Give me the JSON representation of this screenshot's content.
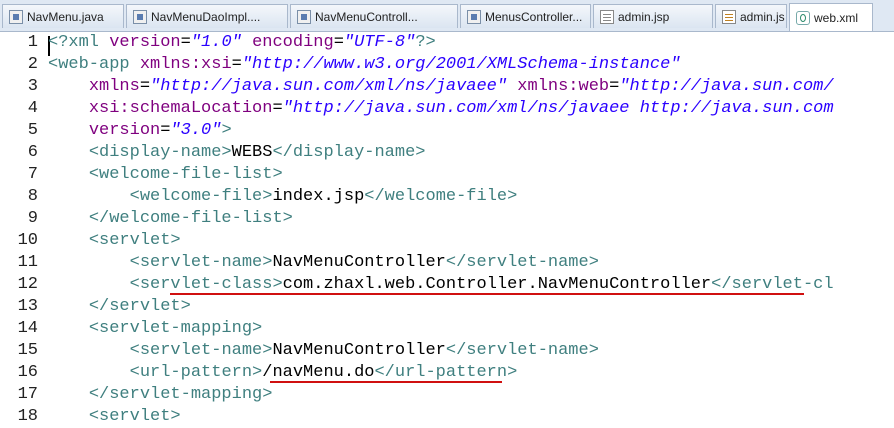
{
  "tabs": [
    {
      "label": "NavMenu.java",
      "icon": "java-file-icon",
      "active": false
    },
    {
      "label": "NavMenuDaoImpl....",
      "icon": "java-file-icon",
      "active": false
    },
    {
      "label": "NavMenuControll...",
      "icon": "java-file-icon",
      "active": false
    },
    {
      "label": "MenusController...",
      "icon": "java-file-icon",
      "active": false
    },
    {
      "label": "admin.jsp",
      "icon": "jsp-file-icon",
      "active": false
    },
    {
      "label": "admin.js",
      "icon": "js-file-icon",
      "active": false
    },
    {
      "label": "web.xml",
      "icon": "xml-file-icon",
      "active": true
    }
  ],
  "editor": {
    "lines": [
      {
        "num": "1",
        "tokens": [
          [
            "tag",
            "<?xml "
          ],
          [
            "attr",
            "version"
          ],
          [
            "txt",
            "="
          ],
          [
            "val",
            "\"1.0\""
          ],
          [
            "txt",
            " "
          ],
          [
            "attr",
            "encoding"
          ],
          [
            "txt",
            "="
          ],
          [
            "val",
            "\"UTF-8\""
          ],
          [
            "tag",
            "?>"
          ]
        ]
      },
      {
        "num": "2",
        "tokens": [
          [
            "tag",
            "<web-app "
          ],
          [
            "attr",
            "xmlns:xsi"
          ],
          [
            "txt",
            "="
          ],
          [
            "val",
            "\"http://www.w3.org/2001/XMLSchema-instance\""
          ]
        ]
      },
      {
        "num": "3",
        "tokens": [
          [
            "txt",
            "    "
          ],
          [
            "attr",
            "xmlns"
          ],
          [
            "txt",
            "="
          ],
          [
            "val",
            "\"http://java.sun.com/xml/ns/javaee\""
          ],
          [
            "txt",
            " "
          ],
          [
            "attr",
            "xmlns:web"
          ],
          [
            "txt",
            "="
          ],
          [
            "val",
            "\"http://java.sun.com/"
          ]
        ]
      },
      {
        "num": "4",
        "tokens": [
          [
            "txt",
            "    "
          ],
          [
            "attr",
            "xsi:schemaLocation"
          ],
          [
            "txt",
            "="
          ],
          [
            "val",
            "\"http://java.sun.com/xml/ns/javaee http://java.sun.com"
          ]
        ]
      },
      {
        "num": "5",
        "tokens": [
          [
            "txt",
            "    "
          ],
          [
            "attr",
            "version"
          ],
          [
            "txt",
            "="
          ],
          [
            "val",
            "\"3.0\""
          ],
          [
            "tag",
            ">"
          ]
        ]
      },
      {
        "num": "6",
        "tokens": [
          [
            "txt",
            "    "
          ],
          [
            "tag",
            "<display-name>"
          ],
          [
            "txt",
            "WEBS"
          ],
          [
            "tag",
            "</display-name>"
          ]
        ]
      },
      {
        "num": "7",
        "tokens": [
          [
            "txt",
            "    "
          ],
          [
            "tag",
            "<welcome-file-list>"
          ]
        ]
      },
      {
        "num": "8",
        "tokens": [
          [
            "txt",
            "        "
          ],
          [
            "tag",
            "<welcome-file>"
          ],
          [
            "txt",
            "index.jsp"
          ],
          [
            "tag",
            "</welcome-file>"
          ]
        ]
      },
      {
        "num": "9",
        "tokens": [
          [
            "txt",
            "    "
          ],
          [
            "tag",
            "</welcome-file-list>"
          ]
        ]
      },
      {
        "num": "10",
        "tokens": [
          [
            "txt",
            "    "
          ],
          [
            "tag",
            "<servlet>"
          ]
        ]
      },
      {
        "num": "11",
        "tokens": [
          [
            "txt",
            "        "
          ],
          [
            "tag",
            "<servlet-name>"
          ],
          [
            "txt",
            "NavMenuController"
          ],
          [
            "tag",
            "</servlet-name>"
          ]
        ]
      },
      {
        "num": "12",
        "tokens": [
          [
            "txt",
            "        "
          ],
          [
            "tag",
            "<servlet-class>"
          ],
          [
            "txt",
            "com.zhaxl.web.Controller.NavMenuController"
          ],
          [
            "tag",
            "</servlet-cl"
          ]
        ]
      },
      {
        "num": "13",
        "tokens": [
          [
            "txt",
            "    "
          ],
          [
            "tag",
            "</servlet>"
          ]
        ]
      },
      {
        "num": "14",
        "tokens": [
          [
            "txt",
            "    "
          ],
          [
            "tag",
            "<servlet-mapping>"
          ]
        ]
      },
      {
        "num": "15",
        "tokens": [
          [
            "txt",
            "        "
          ],
          [
            "tag",
            "<servlet-name>"
          ],
          [
            "txt",
            "NavMenuController"
          ],
          [
            "tag",
            "</servlet-name>"
          ]
        ]
      },
      {
        "num": "16",
        "tokens": [
          [
            "txt",
            "        "
          ],
          [
            "tag",
            "<url-pattern>"
          ],
          [
            "txt",
            "/navMenu.do"
          ],
          [
            "tag",
            "</url-pattern>"
          ]
        ]
      },
      {
        "num": "17",
        "tokens": [
          [
            "txt",
            "    "
          ],
          [
            "tag",
            "</servlet-mapping>"
          ]
        ]
      },
      {
        "num": "18",
        "tokens": [
          [
            "txt",
            "    "
          ],
          [
            "tag",
            "<servlet>"
          ]
        ]
      }
    ]
  },
  "colors": {
    "accent_red": "#d01010",
    "tag": "#3f7f7f",
    "attr": "#7f007f",
    "value": "#2a00ff"
  }
}
